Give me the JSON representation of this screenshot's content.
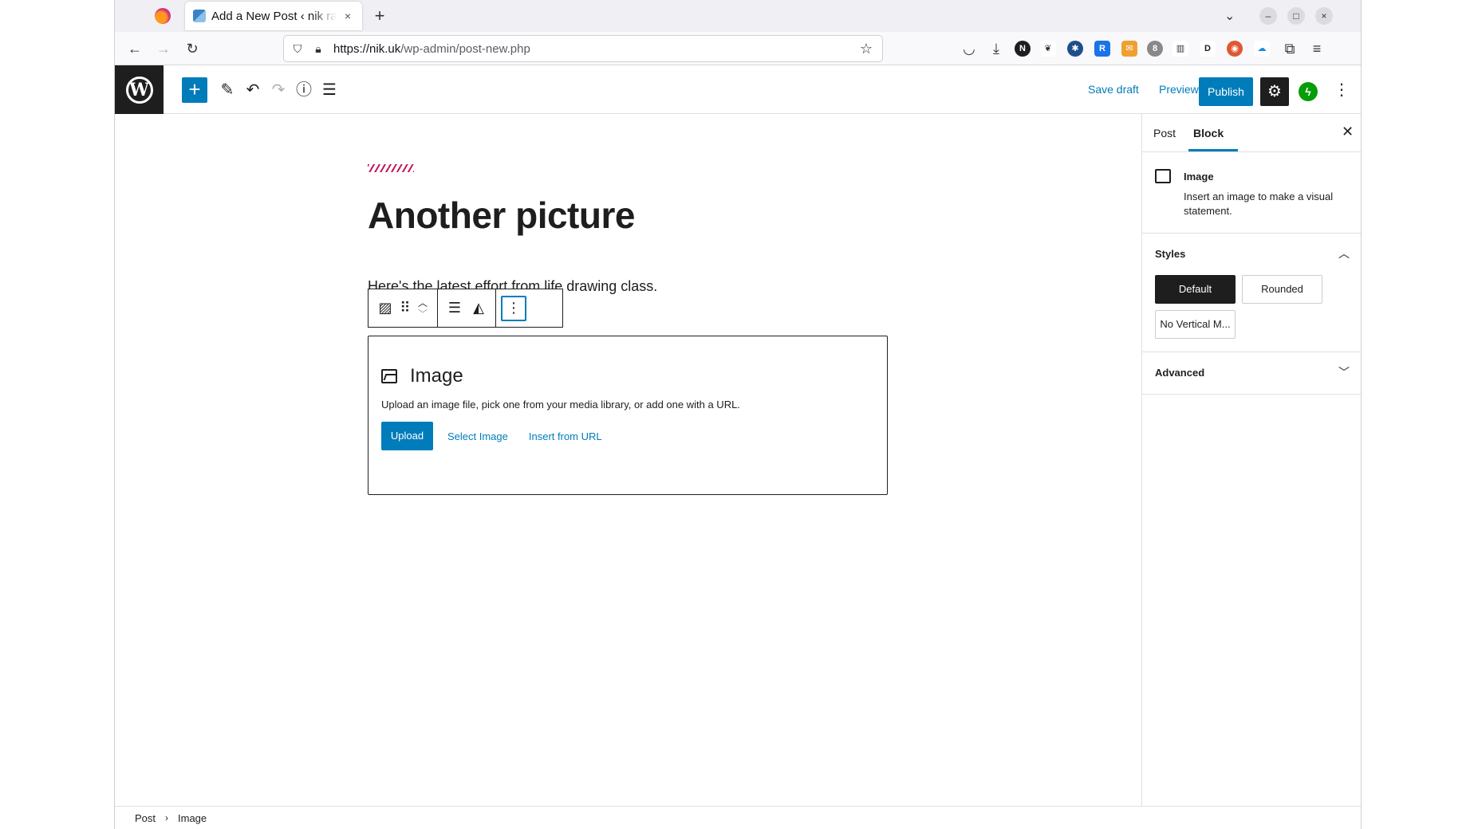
{
  "browser": {
    "tab_title": "Add a New Post ‹ nik rawlinson — WordPress",
    "tab_close": "×",
    "new_tab": "+",
    "url_host": "https://nik.uk",
    "url_path": "/wp-admin/post-new.php",
    "window_minimize": "–",
    "window_maximize": "□",
    "window_close": "×",
    "extension_badge": "8"
  },
  "editor_toolbar": {
    "add_block": "+",
    "save_draft": "Save draft",
    "preview": "Preview",
    "publish": "Publish"
  },
  "post": {
    "title": "Another picture",
    "paragraph": "Here's the latest effort from life drawing class."
  },
  "image_block": {
    "title": "Image",
    "description": "Upload an image file, pick one from your media library, or add one with a URL.",
    "upload": "Upload",
    "select_image": "Select Image",
    "insert_url": "Insert from URL"
  },
  "sidebar": {
    "tabs": [
      {
        "label": "Post"
      },
      {
        "label": "Block"
      }
    ],
    "block_card": {
      "title": "Image",
      "description": "Insert an image to make a visual statement."
    },
    "styles": {
      "title": "Styles",
      "options": [
        "Default",
        "Rounded",
        "No Vertical M..."
      ]
    },
    "advanced": {
      "title": "Advanced"
    }
  },
  "breadcrumb": {
    "items": [
      "Post",
      "Image"
    ]
  },
  "colors": {
    "accent": "#007cba",
    "dark": "#1e1e1e",
    "jetpack": "#069e08"
  }
}
